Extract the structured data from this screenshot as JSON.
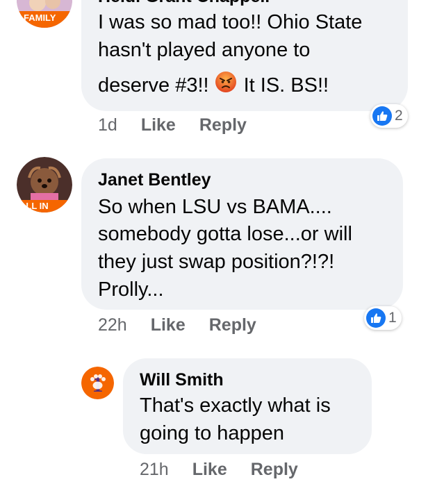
{
  "comments": [
    {
      "author": "Heidi Grant Chappell",
      "avatar_label": "FAMILY",
      "lines": [
        "I was so mad too!! Ohio State",
        "hasn't played anyone to"
      ],
      "last_line_before_emoji": "deserve #3!!",
      "emoji": "angry-face",
      "last_line_after_emoji": "It IS. BS!!",
      "time": "1d",
      "like_label": "Like",
      "reply_label": "Reply",
      "reaction_count": "2"
    },
    {
      "author": "Janet Bentley",
      "avatar_label": "ALL IN",
      "lines": [
        "So when LSU vs BAMA....",
        "somebody gotta lose...or will",
        "they just swap position?!?!",
        "Prolly..."
      ],
      "time": "22h",
      "like_label": "Like",
      "reply_label": "Reply",
      "reaction_count": "1"
    },
    {
      "author": "Will Smith",
      "lines": [
        "That's exactly what is",
        "going to happen"
      ],
      "time": "21h",
      "like_label": "Like",
      "reply_label": "Reply"
    }
  ],
  "colors": {
    "bubble": "#f0f2f5",
    "meta_text": "#65676b",
    "like_blue": "#1877f2",
    "clemson_orange": "#f56600"
  }
}
